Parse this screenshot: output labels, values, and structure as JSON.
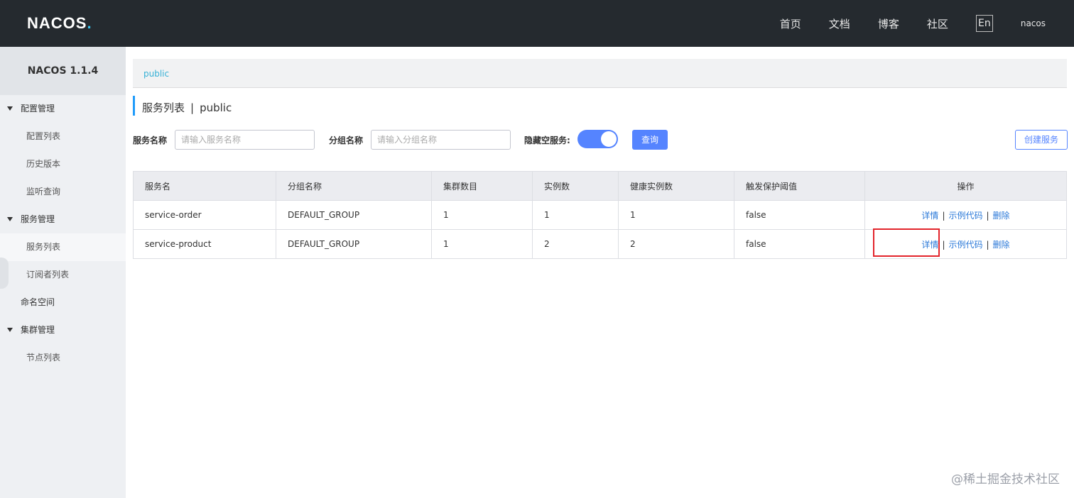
{
  "header": {
    "logo_text": "NACOS",
    "logo_dot": ".",
    "nav": [
      "首页",
      "文档",
      "博客",
      "社区"
    ],
    "lang": "En",
    "user": "nacos"
  },
  "sidebar": {
    "version": "NACOS 1.1.4",
    "groups": [
      {
        "label": "配置管理",
        "items": [
          "配置列表",
          "历史版本",
          "监听查询"
        ]
      },
      {
        "label": "服务管理",
        "items": [
          "服务列表",
          "订阅者列表"
        ]
      },
      {
        "label": "命名空间"
      },
      {
        "label": "集群管理",
        "items": [
          "节点列表"
        ]
      }
    ],
    "active_item": "服务列表"
  },
  "breadcrumb": "public",
  "title": {
    "main": "服务列表",
    "sep": "|",
    "namespace": "public"
  },
  "filters": {
    "service_name_label": "服务名称",
    "service_name_placeholder": "请输入服务名称",
    "group_name_label": "分组名称",
    "group_name_placeholder": "请输入分组名称",
    "hide_empty_label": "隐藏空服务:",
    "hide_empty_on": true,
    "query_button": "查询",
    "create_button": "创建服务"
  },
  "table": {
    "headers": [
      "服务名",
      "分组名称",
      "集群数目",
      "实例数",
      "健康实例数",
      "触发保护阈值",
      "操作"
    ],
    "rows": [
      {
        "name": "service-order",
        "group": "DEFAULT_GROUP",
        "clusters": "1",
        "instances": "1",
        "healthy": "1",
        "threshold": "false"
      },
      {
        "name": "service-product",
        "group": "DEFAULT_GROUP",
        "clusters": "1",
        "instances": "2",
        "healthy": "2",
        "threshold": "false"
      }
    ],
    "ops": {
      "detail": "详情",
      "sample": "示例代码",
      "delete": "删除",
      "sep": "|"
    }
  },
  "watermark": "@稀土掘金技术社区",
  "colors": {
    "primary": "#5584ff",
    "header_bg": "#252a2f",
    "link": "#2a78d8",
    "highlight": "#e3242b"
  }
}
